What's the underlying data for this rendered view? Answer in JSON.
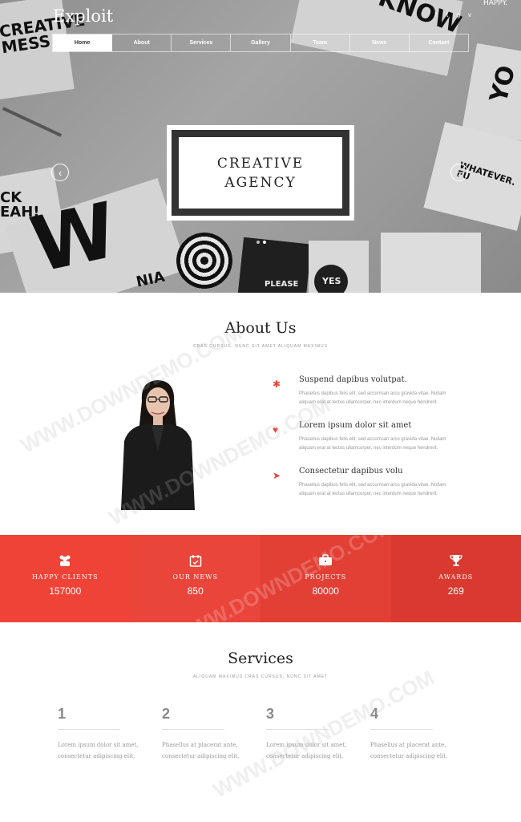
{
  "header": {
    "logo": "Exploit",
    "social_icons": [
      "facebook-icon",
      "twitter-icon",
      "google-plus-icon",
      "vk-icon"
    ],
    "nav": [
      "Home",
      "About",
      "Services",
      "Gallery",
      "Team",
      "News",
      "Contact"
    ]
  },
  "hero": {
    "line1": "CREATIVE",
    "line2": "AGENCY",
    "background_texts": {
      "creative_mess": "CREATIVE\nMESS",
      "know": "KNOW",
      "happy": "HAPPY.",
      "yo": "YO",
      "whatever": "WHATEVER. FU",
      "ck_yeah": "CK\nEAH!",
      "w": "W",
      "nia": "NIA",
      "please": "PLEASE",
      "yes": "YES"
    }
  },
  "about": {
    "title": "About Us",
    "subtitle": "CRAS CURSUS, NUNC SIT AMET ALIQUAM MAXIMUS",
    "features": [
      {
        "icon": "gear-icon",
        "title": "Suspend dapibus volutpat.",
        "text": "Phasellus dapibus felis elit, sed accumsan arcu gravida vitae. Nullam aliquam erat at lectus ullamcorper, nec interdum neque hendrerit."
      },
      {
        "icon": "heart-icon",
        "title": "Lorem ipsum dolor sit amet",
        "text": "Phasellus dapibus felis elit, sed accumsan arcu gravida vitae. Nullam aliquam erat at lectus ullamcorper, nec interdum neque hendrerit."
      },
      {
        "icon": "paper-plane-icon",
        "title": "Consectetur dapibus volu",
        "text": "Phasellus dapibus felis elit, sed accumsan arcu gravida vitae. Nullam aliquam erat at lectus ullamcorper, nec interdum neque hendrerit."
      }
    ]
  },
  "stats": [
    {
      "icon": "users-icon",
      "label": "HAPPY CLIENTS",
      "value": "157000",
      "color": "#ef4338"
    },
    {
      "icon": "calendar-check-icon",
      "label": "OUR NEWS",
      "value": "850",
      "color": "#e9453b"
    },
    {
      "icon": "briefcase-icon",
      "label": "PROJECTS",
      "value": "80000",
      "color": "#e23f35"
    },
    {
      "icon": "trophy-icon",
      "label": "AWARDS",
      "value": "269",
      "color": "#d9392f"
    }
  ],
  "services": {
    "title": "Services",
    "subtitle": "ALIQUAM MAXIMUS CRAS CURSUS, NUNC SIT AMET",
    "items": [
      {
        "num": "1",
        "text": "Lorem ipsum dolor sit amet, consectetur adipiscing elit."
      },
      {
        "num": "2",
        "text": "Phasellus at placerat ante, consectetur adipiscing elit."
      },
      {
        "num": "3",
        "text": "Lorem ipsum dolor sit amet, consectetur adipiscing elit."
      },
      {
        "num": "4",
        "text": "Phasellus at placerat ante, consectetur adipiscing elit."
      }
    ]
  },
  "watermark": "WWW.DOWNDEMO.COM",
  "colors": {
    "accent": "#e8453c",
    "text_dark": "#222222",
    "text_muted": "#999999"
  }
}
